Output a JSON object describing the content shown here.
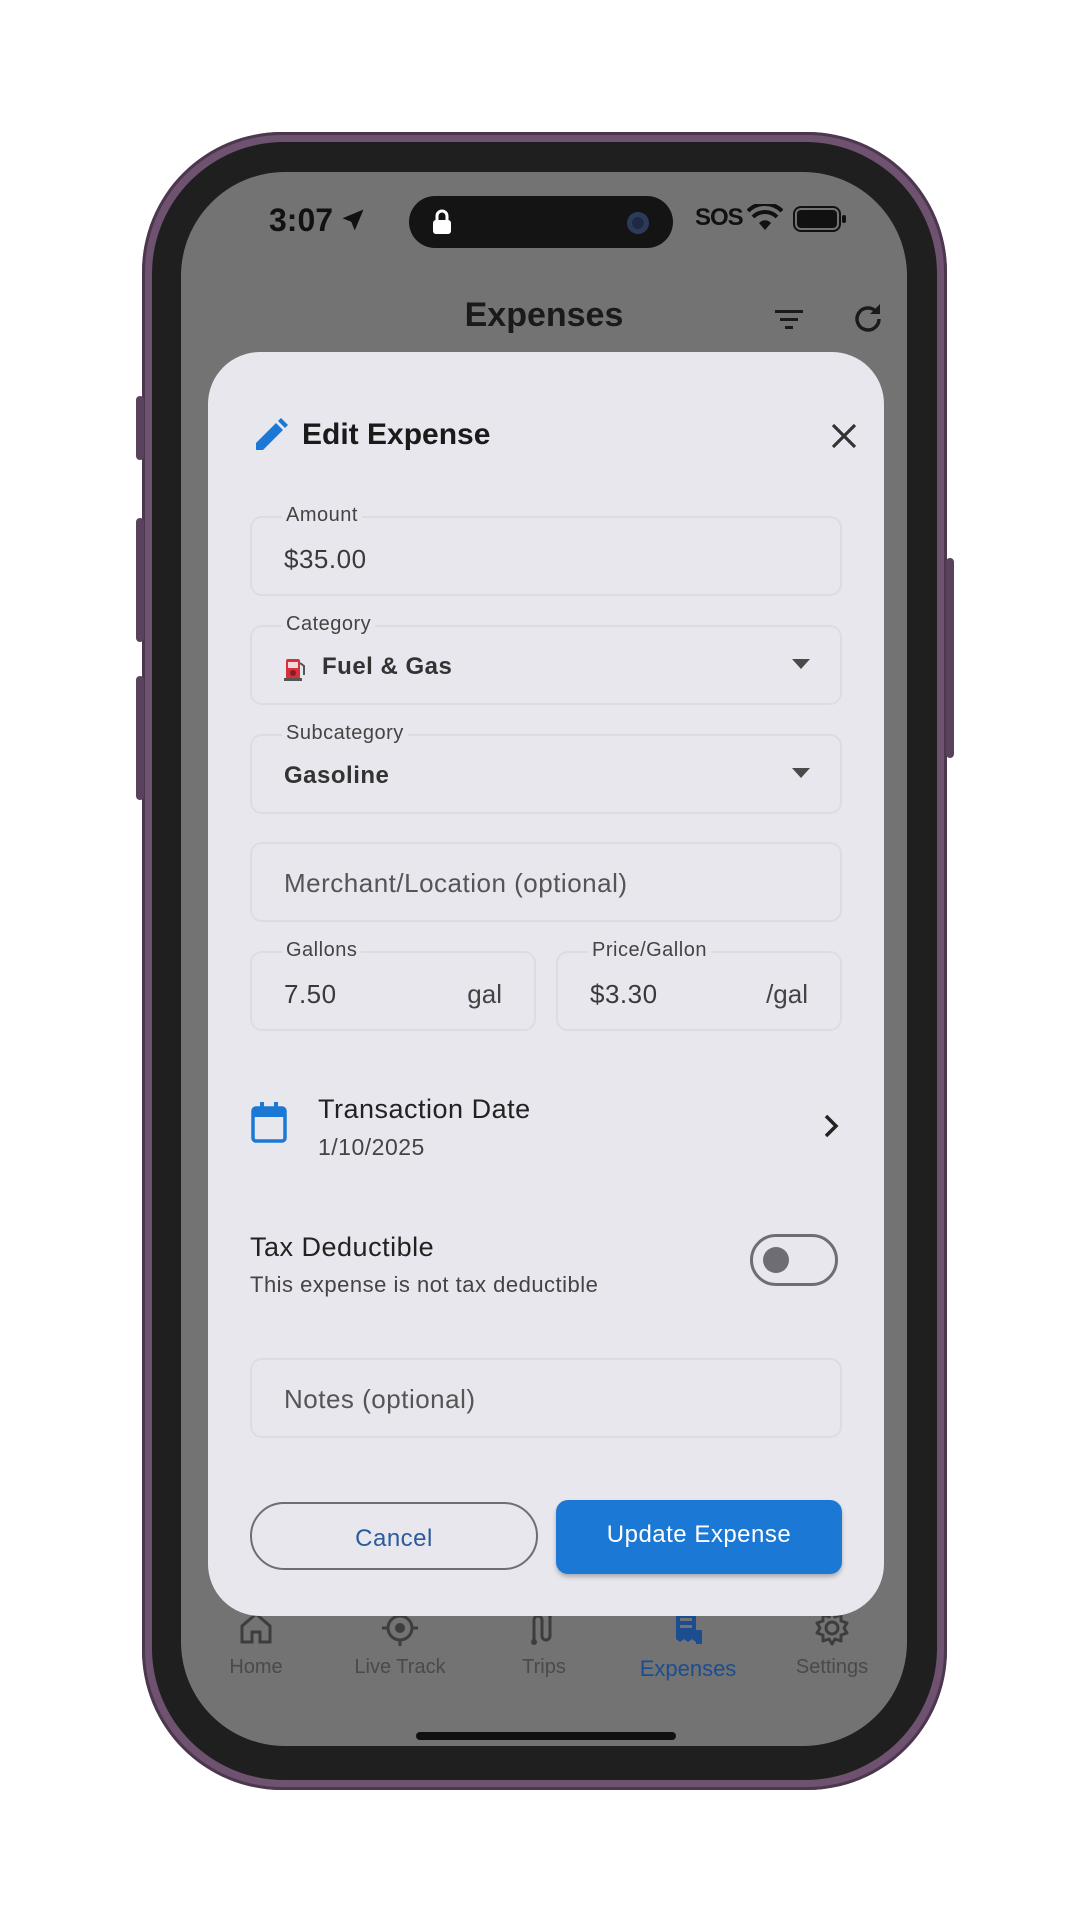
{
  "status_bar": {
    "time": "3:07",
    "sos": "SOS"
  },
  "app_bar": {
    "title": "Expenses"
  },
  "modal": {
    "title": "Edit Expense",
    "amount": {
      "label": "Amount",
      "value": "$35.00"
    },
    "category": {
      "label": "Category",
      "value": "Fuel & Gas"
    },
    "subcategory": {
      "label": "Subcategory",
      "value": "Gasoline"
    },
    "merchant": {
      "placeholder": "Merchant/Location (optional)"
    },
    "gallons": {
      "label": "Gallons",
      "value": "7.50",
      "suffix": "gal"
    },
    "price_per_gallon": {
      "label": "Price/Gallon",
      "value": "$3.30",
      "suffix": "/gal"
    },
    "transaction_date": {
      "label": "Transaction Date",
      "value": "1/10/2025"
    },
    "tax_deductible": {
      "label": "Tax Deductible",
      "description": "This expense is not tax deductible",
      "enabled": false
    },
    "notes": {
      "placeholder": "Notes (optional)"
    },
    "cancel_label": "Cancel",
    "update_label": "Update Expense"
  },
  "bottom_nav": {
    "items": [
      {
        "label": "Home",
        "icon": "home-icon",
        "active": false
      },
      {
        "label": "Live Track",
        "icon": "gps-icon",
        "active": false
      },
      {
        "label": "Trips",
        "icon": "route-icon",
        "active": false
      },
      {
        "label": "Expenses",
        "icon": "receipt-icon",
        "active": true
      },
      {
        "label": "Settings",
        "icon": "gear-icon",
        "active": false
      }
    ]
  },
  "colors": {
    "accent": "#1b78d4",
    "active_nav": "#1b4d8f",
    "modal_bg": "#e7e7ed",
    "overlay": "#737373"
  }
}
